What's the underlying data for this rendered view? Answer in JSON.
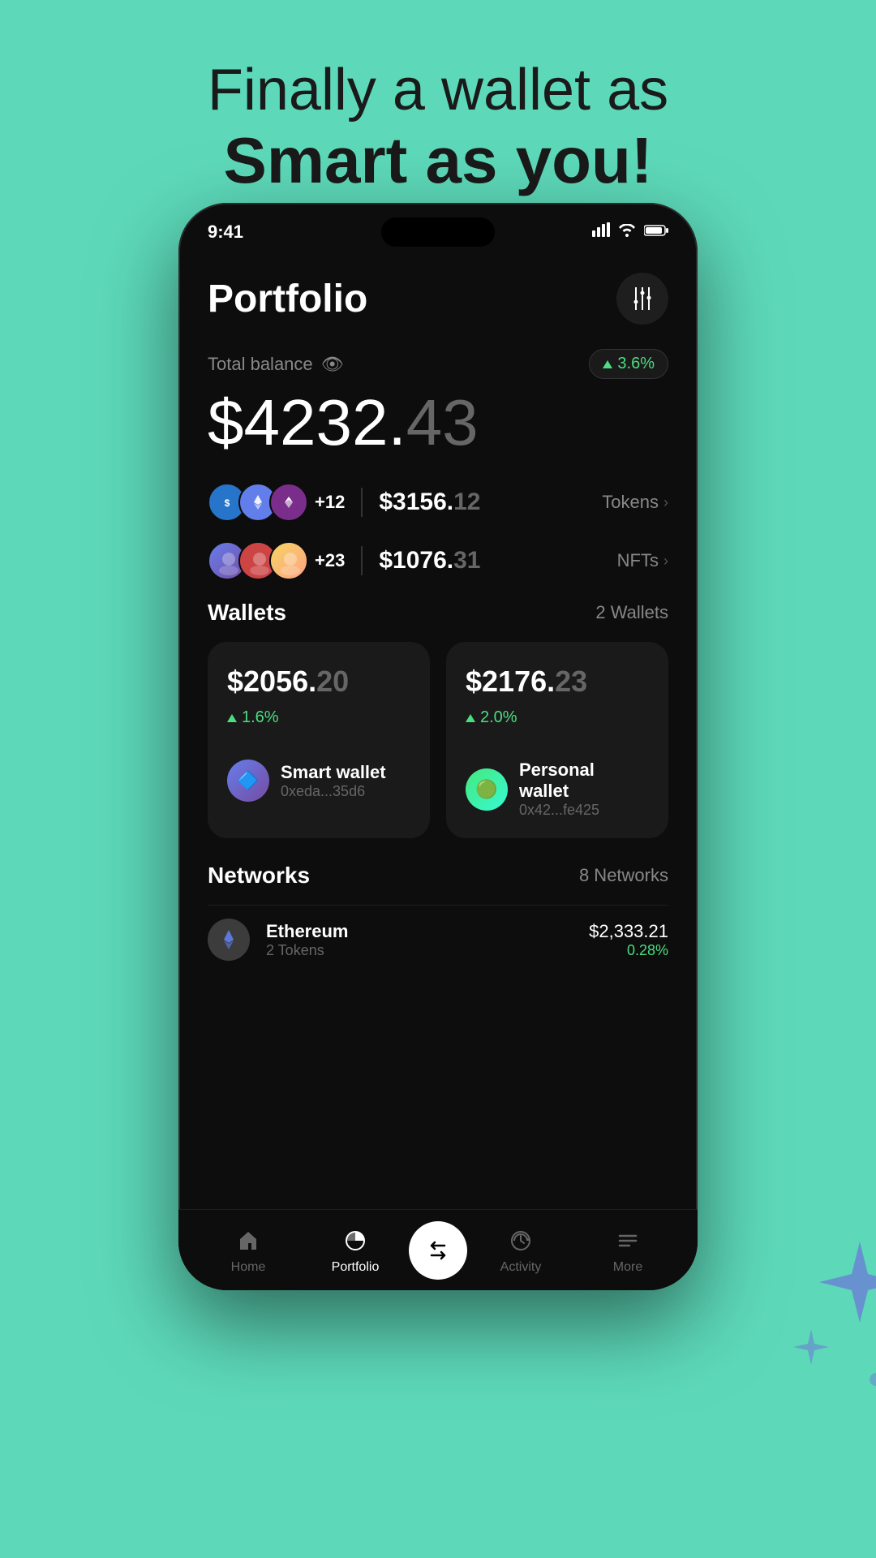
{
  "hero": {
    "line1": "Finally a wallet as",
    "line2": "Smart as you!"
  },
  "status_bar": {
    "time": "9:41",
    "signal": "●●●●",
    "wifi": "wifi",
    "battery": "battery"
  },
  "header": {
    "title": "Portfolio",
    "settings_icon": "⇄"
  },
  "balance": {
    "label": "Total balance",
    "amount_whole": "$4232.",
    "amount_cents": "43",
    "change_pct": "3.6%"
  },
  "tokens": {
    "count": "+12",
    "value_whole": "$3156.",
    "value_cents": "12",
    "label": "Tokens"
  },
  "nfts": {
    "count": "+23",
    "value_whole": "$1076.",
    "value_cents": "31",
    "label": "NFTs"
  },
  "wallets": {
    "section_title": "Wallets",
    "section_count": "2 Wallets",
    "wallet1": {
      "amount_whole": "$2056.",
      "amount_cents": "20",
      "change": "1.6%",
      "name": "Smart wallet",
      "address": "0xeda...35d6"
    },
    "wallet2": {
      "amount_whole": "$2176.",
      "amount_cents": "23",
      "change": "2.0%",
      "name": "Personal wallet",
      "address": "0x42...fe425"
    }
  },
  "networks": {
    "section_title": "Networks",
    "section_count": "8 Networks",
    "ethereum": {
      "name": "Ethereum",
      "tokens": "2 Tokens",
      "value": "$2,333.21",
      "change": "0.28%"
    }
  },
  "tab_bar": {
    "home": "Home",
    "portfolio": "Portfolio",
    "swap": "⇄",
    "activity": "Activity",
    "more": "More"
  }
}
